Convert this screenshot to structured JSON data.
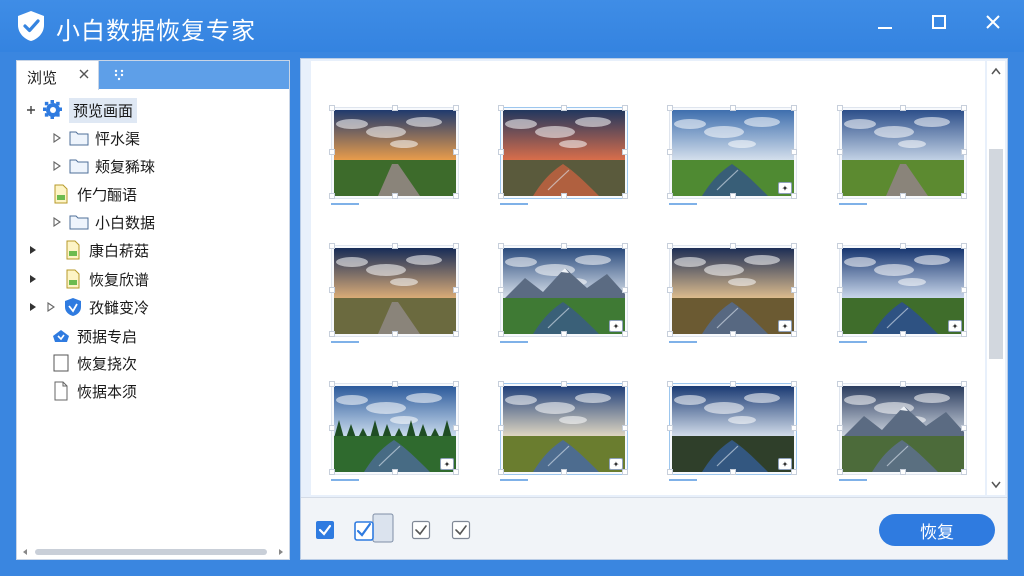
{
  "app": {
    "title": "小白数据恢复专家",
    "brand_color": "#3584e0",
    "logo_icon": "shield-check-icon"
  },
  "window_controls": [
    "minimize-icon",
    "maximize-icon",
    "close-icon"
  ],
  "left_panel": {
    "tab_label": "浏览",
    "tree": [
      {
        "label": "预览画面",
        "icon": "gear-icon",
        "expander": "plus",
        "selected": true
      },
      {
        "label": "怦水渠",
        "icon": "folder-icon",
        "expander": "collapsed-outline"
      },
      {
        "label": "颊复豨琜",
        "icon": "folder-icon",
        "expander": "collapsed-outline"
      },
      {
        "label": "作勹酾语",
        "icon": "document-icon",
        "expander": "none"
      },
      {
        "label": "小白数据",
        "icon": "folder-icon",
        "expander": "collapsed-outline"
      },
      {
        "label": "康白菥菇",
        "icon": "document-icon",
        "expander": "collapsed-filled"
      },
      {
        "label": "恢复欣谱",
        "icon": "document-icon",
        "expander": "collapsed-filled"
      },
      {
        "label": "孜雠变冷",
        "icon": "shield-icon",
        "expander": "both"
      },
      {
        "label": "预据专启",
        "icon": "cloud-icon",
        "expander": "none"
      },
      {
        "label": "恢复挠次",
        "icon": "blank-page-icon",
        "expander": "none"
      },
      {
        "label": "恢据本须",
        "icon": "file-page-icon",
        "expander": "none"
      }
    ]
  },
  "gallery": {
    "images": [
      {
        "scene": "sunset-road"
      },
      {
        "scene": "sunset-river"
      },
      {
        "scene": "river-field"
      },
      {
        "scene": "sky-road"
      },
      {
        "scene": "stormy-road"
      },
      {
        "scene": "mountain-lake"
      },
      {
        "scene": "dusk-lake"
      },
      {
        "scene": "blue-lake"
      },
      {
        "scene": "forest-river"
      },
      {
        "scene": "marsh-reflection"
      },
      {
        "scene": "cloud-reflection"
      },
      {
        "scene": "cliff-lake"
      }
    ]
  },
  "bottom_bar": {
    "restore_label": "恢复"
  }
}
